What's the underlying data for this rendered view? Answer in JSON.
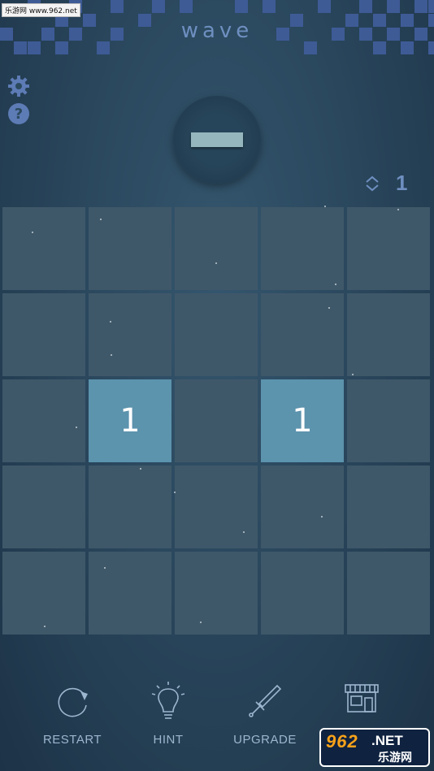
{
  "watermark": "乐游网 www.962.net",
  "app": {
    "title": "wave"
  },
  "target": {
    "shape": "bar"
  },
  "moves": {
    "count": "1",
    "icon": "swap-arrows-icon"
  },
  "board": {
    "rows": 5,
    "cols": 5,
    "cells": [
      [
        "",
        "",
        "",
        "",
        ""
      ],
      [
        "",
        "",
        "",
        "",
        ""
      ],
      [
        "",
        "1",
        "",
        "1",
        ""
      ],
      [
        "",
        "",
        "",
        "",
        ""
      ],
      [
        "",
        "",
        "",
        "",
        ""
      ]
    ]
  },
  "toolbar": {
    "restart_label": "RESTART",
    "hint_label": "HINT",
    "upgrade_label": "UPGRADE",
    "shop_label": ""
  },
  "badge": {
    "big": "962",
    "net": ".NET",
    "cn": "乐游网"
  },
  "colors": {
    "background": "#2a475d",
    "cell": "#3f5869",
    "cell_active": "#5c93ad",
    "accent": "#6f8fc0",
    "pixel": "#3e5b96"
  }
}
